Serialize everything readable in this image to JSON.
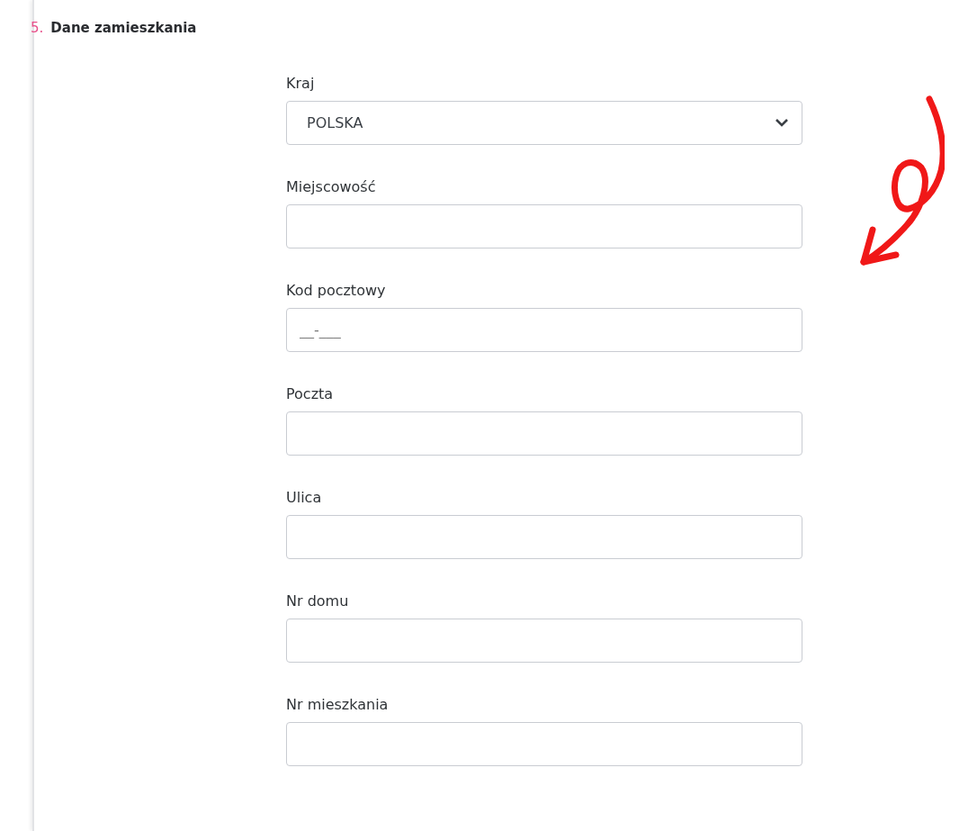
{
  "section": {
    "number": "5.",
    "title": "Dane zamieszkania"
  },
  "fields": [
    {
      "kind": "select",
      "label": "Kraj",
      "value": "POLSKA"
    },
    {
      "kind": "text",
      "label": "Miejscowość"
    },
    {
      "kind": "text",
      "label": "Kod pocztowy",
      "placeholder": "__-___"
    },
    {
      "kind": "text",
      "label": "Poczta"
    },
    {
      "kind": "text",
      "label": "Ulica"
    },
    {
      "kind": "text",
      "label": "Nr domu"
    },
    {
      "kind": "text",
      "label": "Nr mieszkania"
    }
  ]
}
